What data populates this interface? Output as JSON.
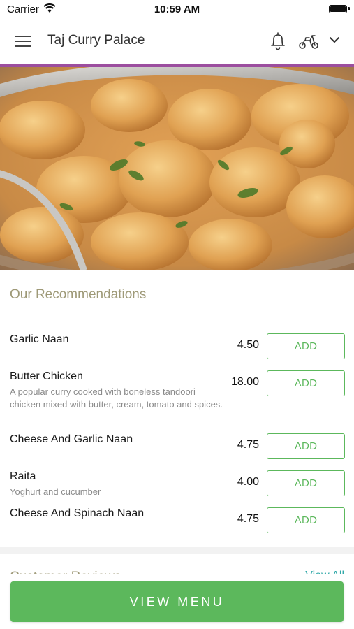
{
  "status_bar": {
    "carrier": "Carrier",
    "time": "10:59 AM",
    "icons": [
      "wifi-icon",
      "battery-icon"
    ]
  },
  "header": {
    "title": "Taj Curry Palace",
    "icons": [
      "menu-icon",
      "bell-icon",
      "scooter-icon",
      "chevron-down-icon"
    ],
    "accent_color": "#9c4e9f"
  },
  "hero": {
    "image": "curry-dish-photo"
  },
  "recommendations": {
    "title": "Our Recommendations",
    "add_label": "ADD",
    "items": [
      {
        "name": "Garlic Naan",
        "description": "",
        "price": "4.50"
      },
      {
        "name": "Butter Chicken",
        "description": "A popular curry cooked with boneless tandoori chicken mixed with butter, cream, tomato and spices.",
        "price": "18.00"
      },
      {
        "name": "Cheese And Garlic Naan",
        "description": "",
        "price": "4.75"
      },
      {
        "name": "Raita",
        "description": "Yoghurt and cucumber",
        "price": "4.00"
      },
      {
        "name": "Cheese And Spinach Naan",
        "description": "",
        "price": "4.75"
      }
    ]
  },
  "reviews": {
    "title": "Customer Reviews",
    "link": "View All"
  },
  "footer": {
    "view_menu_label": "VIEW MENU"
  },
  "colors": {
    "primary_green": "#5cb85c",
    "section_title": "#9e9977",
    "link_teal": "#2fa8a8"
  }
}
